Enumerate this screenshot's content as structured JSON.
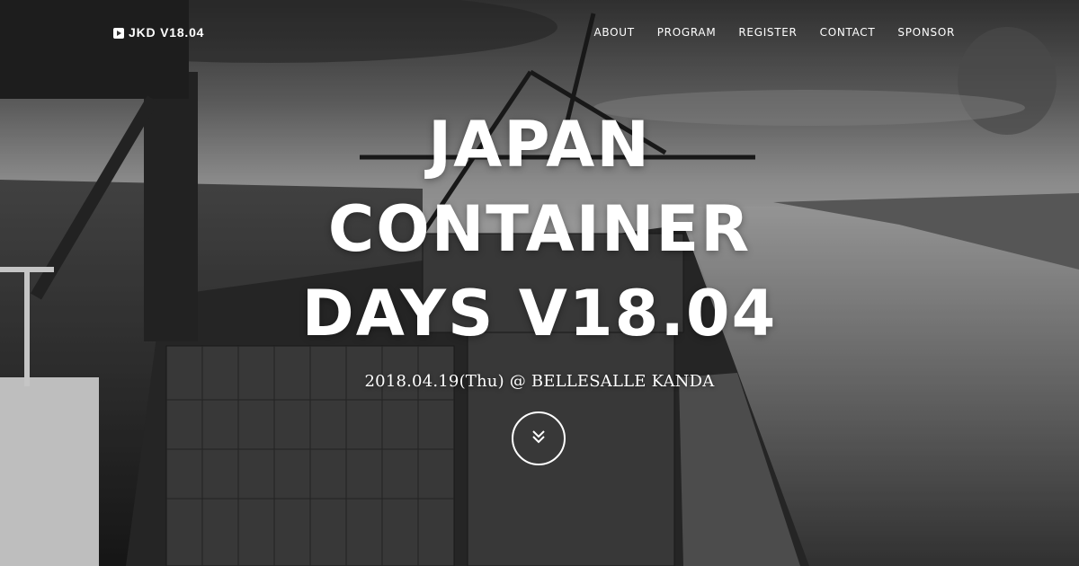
{
  "brand": {
    "label": "JKD V18.04",
    "icon": "play-circle-icon"
  },
  "nav": {
    "items": [
      {
        "label": "ABOUT"
      },
      {
        "label": "PROGRAM"
      },
      {
        "label": "REGISTER"
      },
      {
        "label": "CONTACT"
      },
      {
        "label": "SPONSOR"
      }
    ]
  },
  "hero": {
    "title_lines": [
      "JAPAN",
      "CONTAINER",
      "DAYS V18.04"
    ],
    "subtitle": "2018.04.19(Thu) @ BELLESALLE KANDA",
    "scroll_icon": "double-chevron-down-icon"
  },
  "colors": {
    "text": "#ffffff",
    "background_tone": "#7a7a7a"
  }
}
